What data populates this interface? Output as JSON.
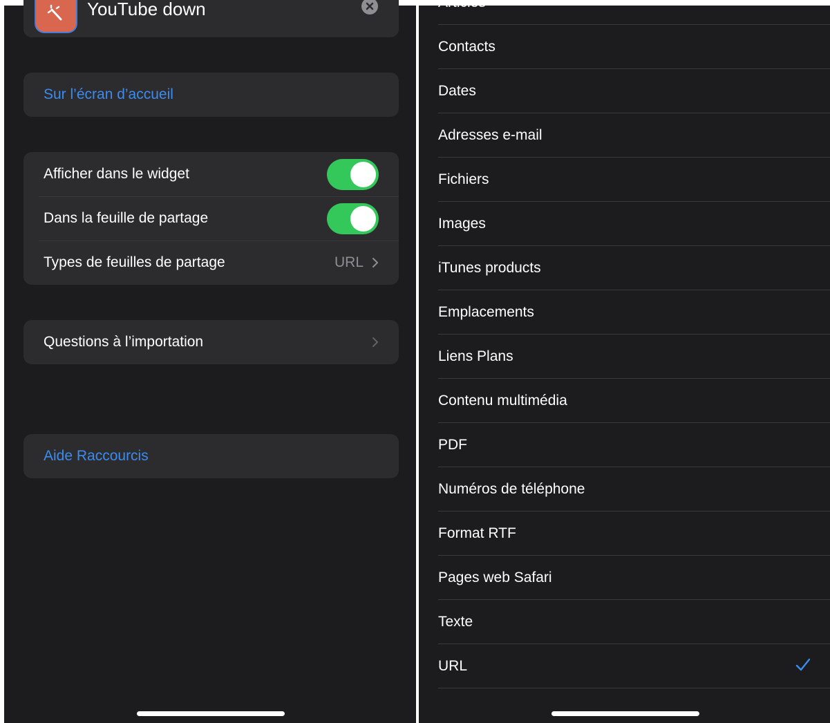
{
  "left": {
    "app": {
      "name": "YouTube down",
      "icon": "shortcut-app-icon",
      "icon_color": "#d9674f"
    },
    "home_screen_link": "Sur l’écran d’accueil",
    "settings": [
      {
        "label": "Afficher dans le widget",
        "toggle": true
      },
      {
        "label": "Dans la feuille de partage",
        "toggle": true
      },
      {
        "label": "Types de feuilles de partage",
        "value": "URL"
      }
    ],
    "import_questions": "Questions à l’importation",
    "help_link": "Aide Raccourcis"
  },
  "right": {
    "items": [
      {
        "label": "Articles",
        "checked": false
      },
      {
        "label": "Contacts",
        "checked": false
      },
      {
        "label": "Dates",
        "checked": false
      },
      {
        "label": "Adresses e-mail",
        "checked": false
      },
      {
        "label": "Fichiers",
        "checked": false
      },
      {
        "label": "Images",
        "checked": false
      },
      {
        "label": "iTunes products",
        "checked": false
      },
      {
        "label": "Emplacements",
        "checked": false
      },
      {
        "label": "Liens Plans",
        "checked": false
      },
      {
        "label": "Contenu multimédia",
        "checked": false
      },
      {
        "label": "PDF",
        "checked": false
      },
      {
        "label": "Numéros de téléphone",
        "checked": false
      },
      {
        "label": "Format RTF",
        "checked": false
      },
      {
        "label": "Pages web Safari",
        "checked": false
      },
      {
        "label": "Texte",
        "checked": false
      },
      {
        "label": "URL",
        "checked": true
      }
    ]
  },
  "colors": {
    "accent": "#3b8cf0",
    "toggle_on": "#34c759",
    "background": "#1c1c1e",
    "card": "#2c2c2e"
  }
}
